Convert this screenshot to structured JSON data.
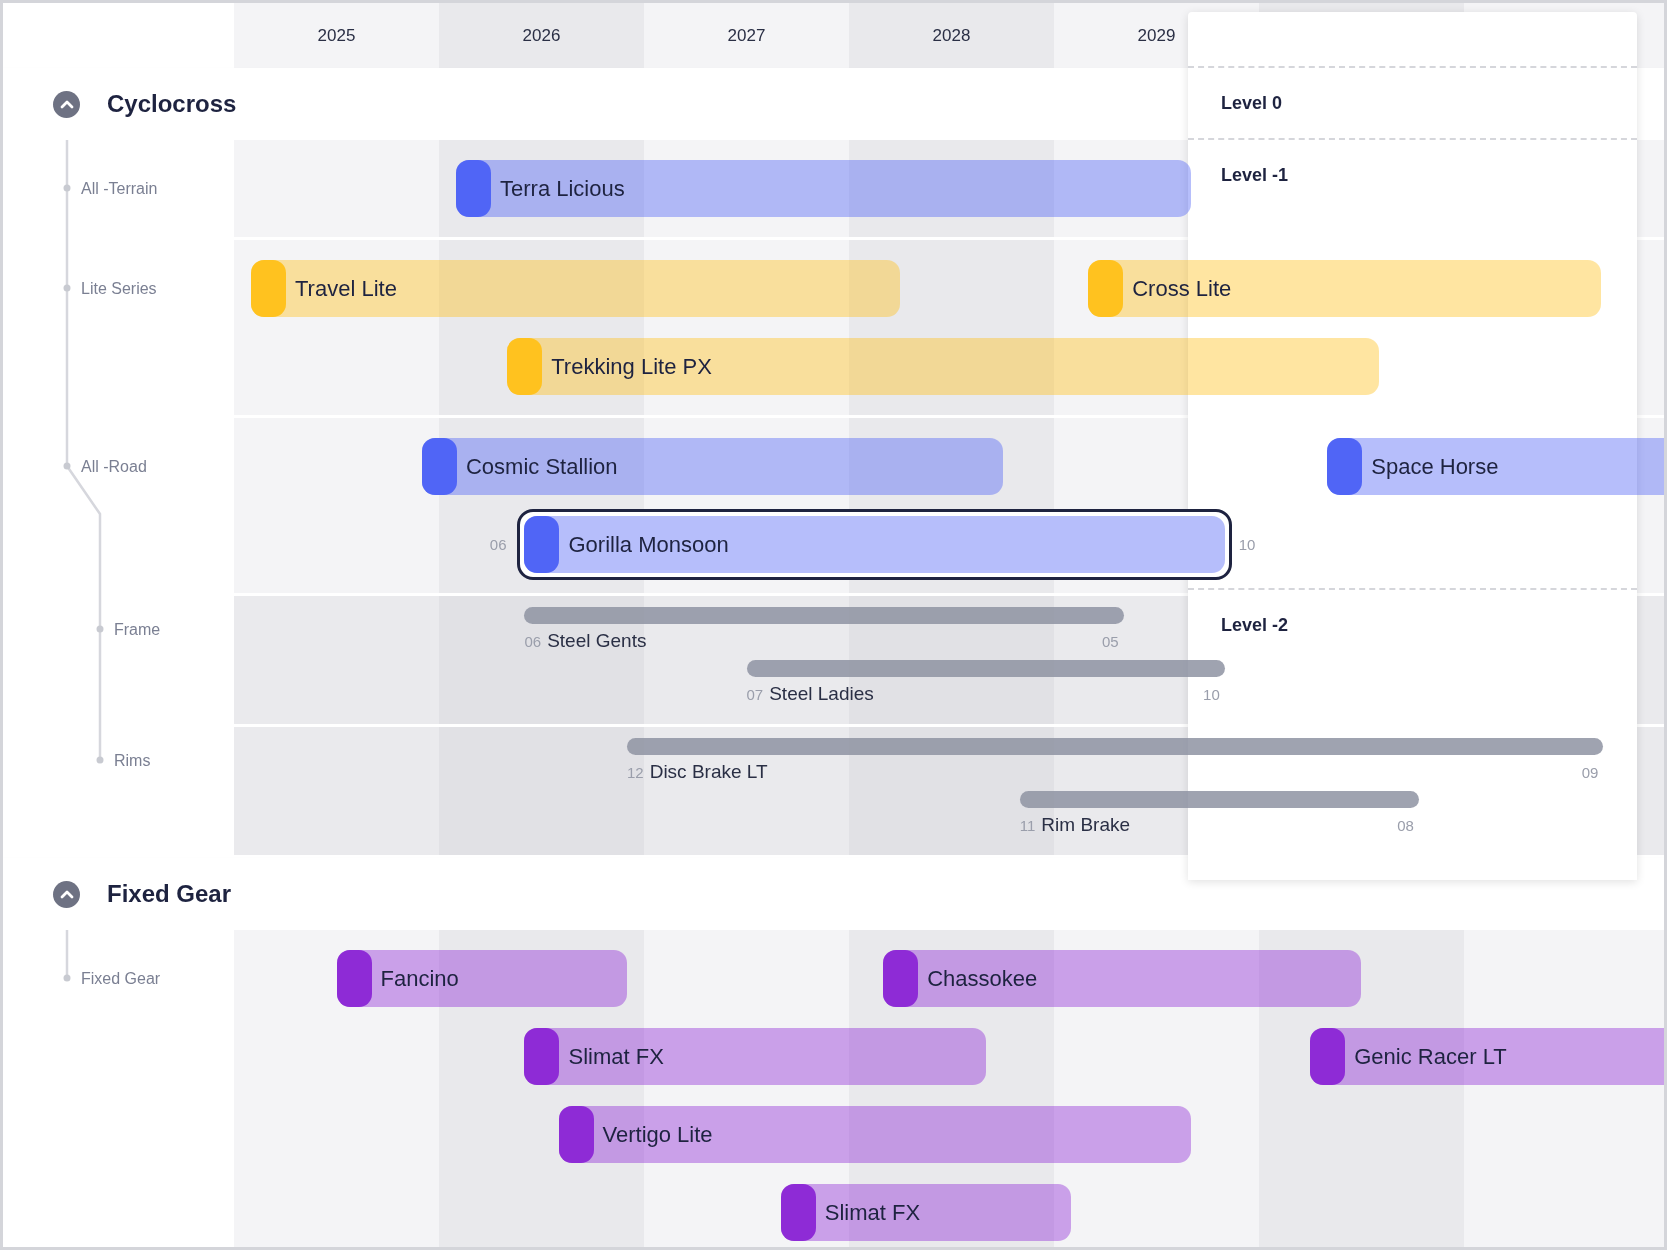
{
  "timeline": {
    "years": [
      "2025",
      "2026",
      "2027",
      "2028",
      "2029"
    ]
  },
  "panel": {
    "levels": [
      {
        "label": "Level 0"
      },
      {
        "label": "Level -1"
      },
      {
        "label": "Level -2"
      }
    ]
  },
  "groups": [
    {
      "title": "Cyclocross",
      "expanded": true,
      "rows": [
        {
          "label": "All -Terrain",
          "kind": "lane",
          "lanes": [
            [
              {
                "name": "Terra Licious",
                "color": "#5065f6",
                "selected": false
              }
            ]
          ]
        },
        {
          "label": "Lite Series",
          "kind": "lane",
          "lanes": [
            [
              {
                "name": "Travel Lite",
                "color": "#ffc21f",
                "selected": false
              },
              {
                "name": "Cross Lite",
                "color": "#ffc21f",
                "selected": false
              }
            ],
            [
              {
                "name": "Trekking Lite PX",
                "color": "#ffc21f",
                "selected": false
              }
            ]
          ]
        },
        {
          "label": "All -Road",
          "kind": "lane",
          "lanes": [
            [
              {
                "name": "Cosmic Stallion",
                "color": "#5065f6",
                "selected": false
              },
              {
                "name": "Space Horse",
                "color": "#5065f6",
                "selected": false
              }
            ],
            [
              {
                "name": "Gorilla Monsoon",
                "start_label": "06",
                "end_label": "10",
                "color": "#5065f6",
                "selected": true
              }
            ]
          ],
          "children": [
            {
              "label": "Frame",
              "kind": "thin",
              "lanes": [
                [
                  {
                    "name": "Steel Gents",
                    "start_label": "06",
                    "end_label": "05"
                  }
                ],
                [
                  {
                    "name": "Steel Ladies",
                    "start_label": "07",
                    "end_label": "10"
                  }
                ]
              ]
            },
            {
              "label": "Rims",
              "kind": "thin",
              "lanes": [
                [
                  {
                    "name": "Disc Brake LT",
                    "start_label": "12",
                    "end_label": "09"
                  }
                ],
                [
                  {
                    "name": "Rim Brake",
                    "start_label": "11",
                    "end_label": "08"
                  }
                ]
              ]
            }
          ]
        }
      ]
    },
    {
      "title": "Fixed Gear",
      "expanded": true,
      "rows": [
        {
          "label": "Fixed Gear",
          "kind": "lane",
          "lanes": [
            [
              {
                "name": "Fancino",
                "color": "#8e2bd6",
                "selected": false
              },
              {
                "name": "Chassokee",
                "color": "#8e2bd6",
                "selected": false
              }
            ],
            [
              {
                "name": "Slimat FX",
                "color": "#8e2bd6",
                "selected": false
              },
              {
                "name": "Genic Racer LT",
                "color": "#8e2bd6",
                "selected": false
              }
            ],
            [
              {
                "name": "Vertigo Lite",
                "color": "#8e2bd6",
                "selected": false
              }
            ],
            [
              {
                "name": "Slimat FX",
                "color": "#8e2bd6",
                "selected": false
              }
            ]
          ]
        }
      ]
    }
  ]
}
